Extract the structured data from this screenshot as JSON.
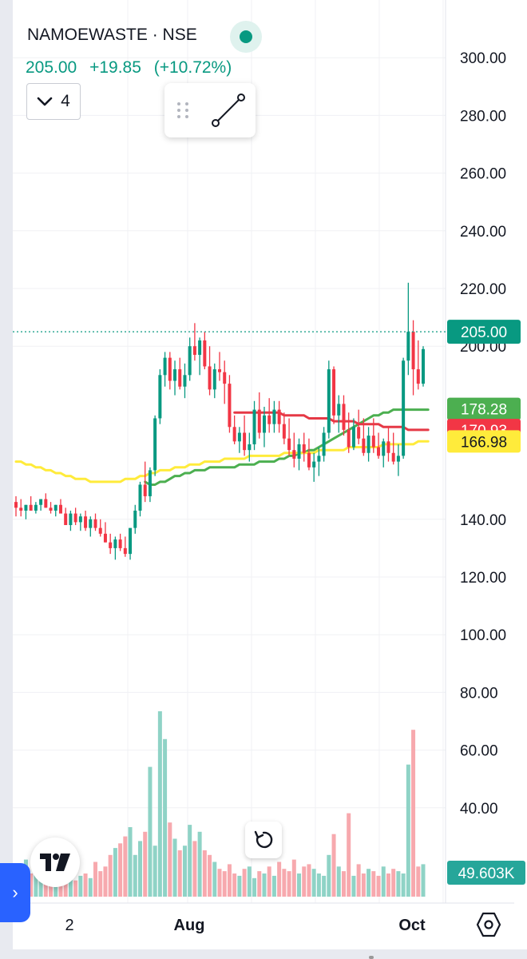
{
  "header": {
    "symbol": "NAMOEWASTE · NSE",
    "price": "205.00",
    "change": "+19.85",
    "change_pct": "(+10.72%)",
    "indicator_count": "4"
  },
  "icons": [
    "live-dot-icon",
    "chevron-down-icon",
    "drag-grip-icon",
    "trend-line-icon",
    "tradingview-logo-icon",
    "reset-icon",
    "chevron-right-icon",
    "settings-hexagon-icon"
  ],
  "colors": {
    "up": "#089981",
    "down": "#f23645",
    "ma_green": "#4caf50",
    "ma_red": "#e53946",
    "ma_yellow": "#ffeb3b",
    "vol_up": "#8fd3c6",
    "vol_down": "#f7a9ae",
    "grid": "#f0f1f4"
  },
  "chart_data": {
    "type": "candlestick",
    "price_axis": {
      "ticks": [
        "300.00",
        "280.00",
        "260.00",
        "240.00",
        "220.00",
        "200.00",
        "140.00",
        "120.00",
        "100.00",
        "80.00",
        "60.00",
        "40.00"
      ],
      "range": [
        20,
        310
      ]
    },
    "x_labels": [
      "2",
      "Aug",
      "Oct"
    ],
    "last_price_label": "205.00",
    "ma_labels": [
      {
        "value": "178.28",
        "color": "#4caf50",
        "text_color": "#ffffff"
      },
      {
        "value": "170.93",
        "color": "#f23645",
        "text_color": "#ffffff"
      },
      {
        "value": "166.98",
        "color": "#ffeb3b",
        "text_color": "#131722"
      }
    ],
    "volume_label": "49.603K",
    "candles": [
      [
        146,
        148,
        141,
        144
      ],
      [
        144,
        147,
        141,
        143
      ],
      [
        143,
        145,
        140,
        145
      ],
      [
        145,
        148,
        143,
        143
      ],
      [
        143,
        146,
        142,
        145
      ],
      [
        145,
        147,
        143,
        147
      ],
      [
        147,
        149,
        144,
        144
      ],
      [
        144,
        146,
        142,
        143
      ],
      [
        143,
        145,
        141,
        145
      ],
      [
        145,
        147,
        143,
        142
      ],
      [
        142,
        144,
        140,
        138
      ],
      [
        138,
        143,
        136,
        142
      ],
      [
        142,
        144,
        138,
        139
      ],
      [
        139,
        142,
        136,
        141
      ],
      [
        141,
        143,
        136,
        137
      ],
      [
        137,
        141,
        134,
        140
      ],
      [
        140,
        142,
        136,
        137
      ],
      [
        137,
        140,
        134,
        135
      ],
      [
        135,
        139,
        132,
        132
      ],
      [
        132,
        135,
        128,
        130
      ],
      [
        130,
        134,
        126,
        133
      ],
      [
        133,
        135,
        129,
        130
      ],
      [
        130,
        134,
        127,
        128
      ],
      [
        128,
        132,
        126,
        137
      ],
      [
        137,
        145,
        135,
        143
      ],
      [
        143,
        153,
        141,
        152
      ],
      [
        152,
        160,
        146,
        148
      ],
      [
        148,
        158,
        146,
        157
      ],
      [
        157,
        176,
        155,
        175
      ],
      [
        175,
        192,
        173,
        190
      ],
      [
        190,
        198,
        186,
        196
      ],
      [
        196,
        198,
        185,
        188
      ],
      [
        188,
        195,
        183,
        192
      ],
      [
        192,
        196,
        185,
        186
      ],
      [
        186,
        194,
        182,
        190
      ],
      [
        190,
        203,
        188,
        200
      ],
      [
        200,
        208,
        195,
        197
      ],
      [
        197,
        203,
        190,
        202
      ],
      [
        202,
        205,
        192,
        193
      ],
      [
        193,
        200,
        183,
        185
      ],
      [
        185,
        194,
        182,
        192
      ],
      [
        192,
        198,
        188,
        191
      ],
      [
        191,
        195,
        180,
        187
      ],
      [
        187,
        190,
        170,
        172
      ],
      [
        172,
        176,
        166,
        167
      ],
      [
        167,
        172,
        163,
        170
      ],
      [
        170,
        176,
        162,
        164
      ],
      [
        164,
        170,
        160,
        166
      ],
      [
        166,
        181,
        164,
        178
      ],
      [
        178,
        184,
        168,
        170
      ],
      [
        170,
        179,
        165,
        176
      ],
      [
        176,
        182,
        170,
        173
      ],
      [
        173,
        181,
        170,
        178
      ],
      [
        178,
        181,
        170,
        173
      ],
      [
        173,
        177,
        166,
        168
      ],
      [
        168,
        175,
        162,
        164
      ],
      [
        164,
        170,
        158,
        161
      ],
      [
        161,
        168,
        157,
        166
      ],
      [
        166,
        170,
        160,
        163
      ],
      [
        163,
        168,
        157,
        158
      ],
      [
        158,
        163,
        153,
        160
      ],
      [
        160,
        165,
        155,
        162
      ],
      [
        162,
        172,
        160,
        170
      ],
      [
        170,
        195,
        168,
        192
      ],
      [
        192,
        193,
        173,
        176
      ],
      [
        176,
        183,
        170,
        180
      ],
      [
        180,
        183,
        169,
        171
      ],
      [
        171,
        177,
        163,
        165
      ],
      [
        165,
        175,
        164,
        172
      ],
      [
        172,
        178,
        166,
        168
      ],
      [
        168,
        175,
        162,
        163
      ],
      [
        163,
        172,
        160,
        169
      ],
      [
        169,
        175,
        163,
        165
      ],
      [
        165,
        170,
        161,
        162
      ],
      [
        162,
        168,
        158,
        167
      ],
      [
        167,
        172,
        160,
        163
      ],
      [
        163,
        170,
        159,
        160
      ],
      [
        160,
        166,
        155,
        162
      ],
      [
        162,
        196,
        161,
        195
      ],
      [
        195,
        222,
        190,
        205
      ],
      [
        205,
        209,
        183,
        192
      ],
      [
        192,
        202,
        185,
        187
      ],
      [
        187,
        200,
        186,
        199
      ]
    ],
    "volume": [
      14,
      12,
      16,
      10,
      13,
      9,
      11,
      12,
      8,
      10,
      12,
      11,
      7,
      9,
      10,
      8,
      15,
      11,
      13,
      18,
      21,
      23,
      26,
      30,
      18,
      24,
      28,
      56,
      22,
      80,
      68,
      32,
      25,
      20,
      22,
      31,
      24,
      28,
      20,
      18,
      15,
      12,
      11,
      14,
      10,
      9,
      12,
      13,
      8,
      11,
      10,
      13,
      9,
      15,
      12,
      11,
      16,
      10,
      13,
      14,
      12,
      10,
      9,
      18,
      27,
      13,
      11,
      36,
      9,
      14,
      10,
      12,
      11,
      9,
      13,
      10,
      12,
      11,
      10,
      57,
      72,
      13,
      14,
      10
    ],
    "moving_averages": [
      {
        "name": "",
        "color": "#4caf50",
        "values": [
          null,
          null,
          null,
          null,
          null,
          null,
          null,
          null,
          null,
          null,
          null,
          null,
          null,
          null,
          null,
          null,
          null,
          null,
          null,
          null,
          null,
          null,
          null,
          null,
          null,
          null,
          153,
          152,
          152,
          153,
          153,
          154,
          155,
          155,
          156,
          156,
          157,
          157,
          157,
          158,
          158,
          158,
          158,
          158,
          158,
          159,
          159,
          159,
          159,
          160,
          160,
          160,
          160,
          161,
          161,
          162,
          162,
          163,
          163,
          164,
          164,
          165,
          166,
          167,
          168,
          169,
          170,
          171,
          172,
          173,
          174,
          175,
          176,
          176,
          177,
          177,
          178,
          178,
          178,
          178,
          178,
          178,
          178,
          178
        ]
      },
      {
        "name": "",
        "color": "#e53946",
        "values": [
          null,
          null,
          null,
          null,
          null,
          null,
          null,
          null,
          null,
          null,
          null,
          null,
          null,
          null,
          null,
          null,
          null,
          null,
          null,
          null,
          null,
          null,
          null,
          null,
          null,
          null,
          null,
          null,
          null,
          null,
          null,
          null,
          null,
          null,
          null,
          null,
          null,
          null,
          null,
          null,
          null,
          null,
          null,
          null,
          177,
          177,
          177,
          177,
          177,
          177,
          177,
          177,
          177,
          177,
          176,
          176,
          176,
          176,
          176,
          175,
          175,
          175,
          175,
          175,
          174,
          174,
          174,
          174,
          174,
          173,
          173,
          173,
          173,
          173,
          172,
          172,
          172,
          172,
          172,
          171,
          171,
          171,
          171,
          171
        ]
      },
      {
        "name": "",
        "color": "#ffeb3b",
        "values": [
          160,
          160,
          159,
          159,
          158,
          158,
          157,
          157,
          156,
          156,
          155,
          155,
          154,
          154,
          154,
          153,
          153,
          153,
          153,
          153,
          153,
          153,
          154,
          154,
          154,
          155,
          155,
          156,
          156,
          157,
          157,
          157,
          158,
          158,
          158,
          159,
          159,
          159,
          160,
          160,
          160,
          160,
          161,
          161,
          161,
          161,
          161,
          162,
          162,
          162,
          162,
          162,
          162,
          162,
          163,
          163,
          163,
          163,
          163,
          163,
          163,
          164,
          164,
          164,
          164,
          164,
          164,
          165,
          165,
          165,
          165,
          165,
          165,
          165,
          166,
          166,
          166,
          166,
          166,
          166,
          166,
          167,
          167,
          167
        ]
      }
    ]
  }
}
